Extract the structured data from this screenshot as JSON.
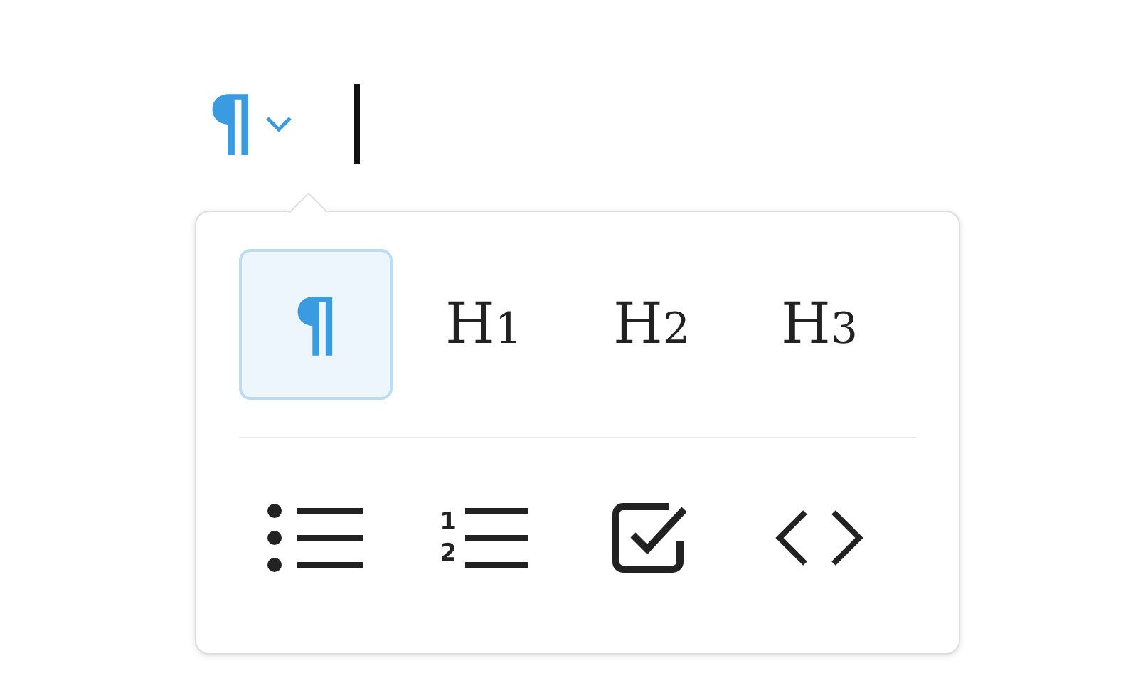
{
  "toolbar": {
    "block_button": {
      "label": "¶"
    }
  },
  "menu": {
    "blocks": [
      {
        "label": "¶",
        "selected": true
      },
      {
        "label": "H$_{1}$",
        "selected": false
      },
      {
        "label": "H$_{2}$",
        "selected": false
      },
      {
        "label": "H$_{3}$",
        "selected": false
      }
    ],
    "lists": [
      {
        "kind": "bullet"
      },
      {
        "kind": "numbered",
        "marks": [
          "1",
          "2"
        ]
      },
      {
        "kind": "task"
      },
      {
        "kind": "code"
      }
    ]
  }
}
